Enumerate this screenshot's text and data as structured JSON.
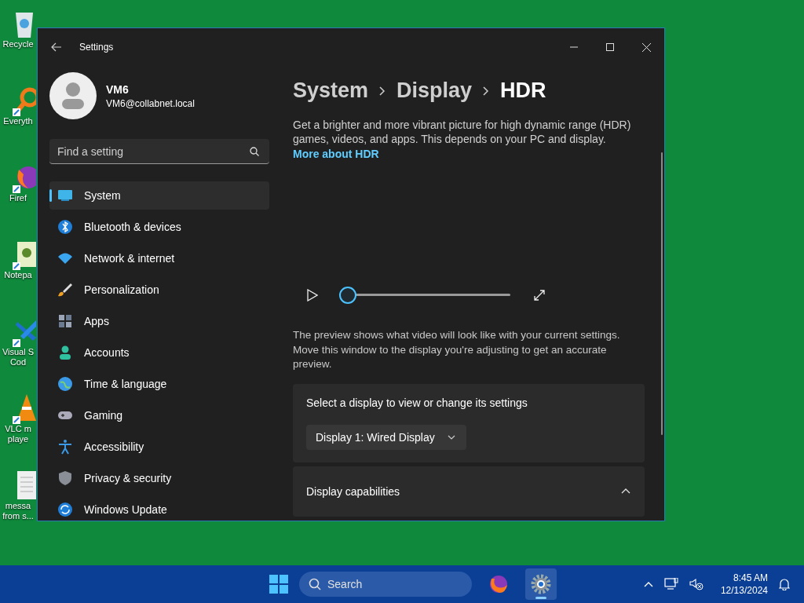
{
  "desktop_icons": [
    {
      "kind": "recycle",
      "lines": [
        "Recycle"
      ]
    },
    {
      "kind": "search",
      "lines": [
        "Everyth"
      ]
    },
    {
      "kind": "browser",
      "lines": [
        "Firef"
      ]
    },
    {
      "kind": "notepad",
      "lines": [
        "Notepa"
      ]
    },
    {
      "kind": "code",
      "lines": [
        "Visual S",
        "Cod"
      ]
    },
    {
      "kind": "cone",
      "lines": [
        "VLC m",
        "playe"
      ]
    },
    {
      "kind": "document",
      "lines": [
        "messa",
        "from s..."
      ]
    }
  ],
  "window": {
    "title": "Settings"
  },
  "account": {
    "name": "VM6",
    "email": "VM6@collabnet.local"
  },
  "search": {
    "placeholder": "Find a setting"
  },
  "nav": [
    {
      "kind": "system",
      "label": "System",
      "selected": true
    },
    {
      "kind": "bluetooth",
      "label": "Bluetooth & devices",
      "selected": false
    },
    {
      "kind": "network",
      "label": "Network & internet",
      "selected": false
    },
    {
      "kind": "personalization",
      "label": "Personalization",
      "selected": false
    },
    {
      "kind": "apps",
      "label": "Apps",
      "selected": false
    },
    {
      "kind": "accounts",
      "label": "Accounts",
      "selected": false
    },
    {
      "kind": "time",
      "label": "Time & language",
      "selected": false
    },
    {
      "kind": "gaming",
      "label": "Gaming",
      "selected": false
    },
    {
      "kind": "accessibility",
      "label": "Accessibility",
      "selected": false
    },
    {
      "kind": "privacy",
      "label": "Privacy & security",
      "selected": false
    },
    {
      "kind": "update",
      "label": "Windows Update",
      "selected": false
    }
  ],
  "breadcrumb": [
    "System",
    "Display",
    "HDR"
  ],
  "description": "Get a brighter and more vibrant picture for high dynamic range (HDR) games, videos, and apps. This depends on your PC and display.",
  "link": "More about HDR",
  "player": {
    "level": 0
  },
  "preview_note": "The preview shows what video will look like with your current settings. Move this window to the display you're adjusting to get an accurate preview.",
  "display_select": {
    "label": "Select a display to view or change its settings",
    "value": "Display 1: Wired Display"
  },
  "capabilities": {
    "title": "Display capabilities",
    "expanded": true
  },
  "taskbar": {
    "search_placeholder": "Search",
    "apps": [
      {
        "kind": "browser",
        "selected": false
      },
      {
        "kind": "settings",
        "selected": true
      }
    ],
    "time": "8:45 AM",
    "date": "12/13/2024"
  }
}
